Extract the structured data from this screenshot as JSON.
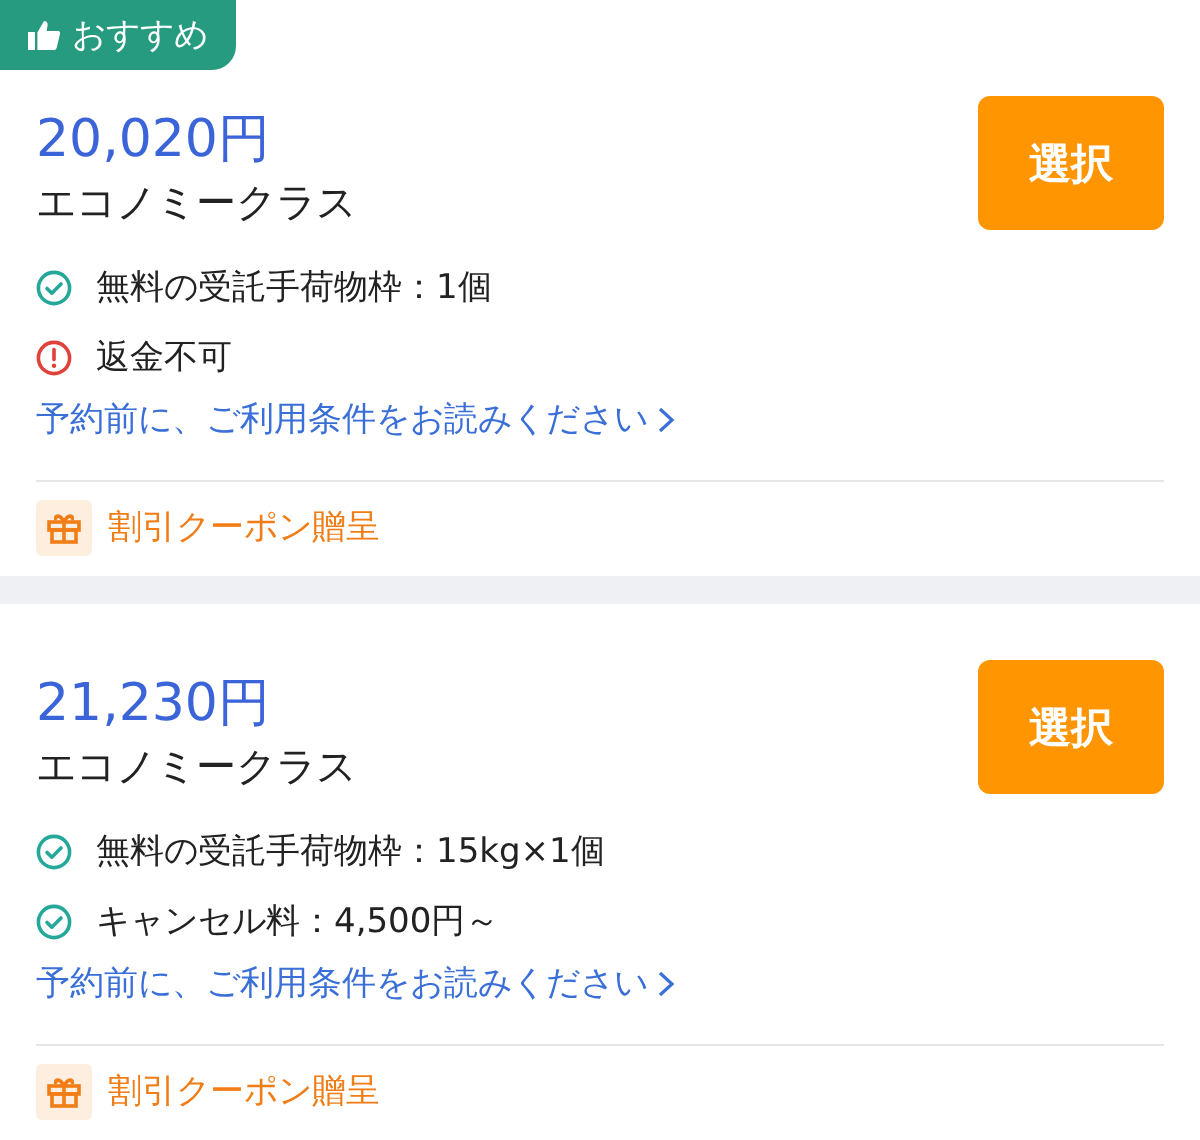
{
  "offers": [
    {
      "badge": {
        "label": "おすすめ"
      },
      "price": "20,020円",
      "fare_class": "エコノミークラス",
      "select_button": "選択",
      "features": [
        {
          "kind": "included",
          "text": "無料の受託手荷物枠：1個"
        },
        {
          "kind": "warning",
          "text": "返金不可"
        }
      ],
      "terms_link": "予約前に、ご利用条件をお読みください",
      "coupon": "割引クーポン贈呈"
    },
    {
      "price": "21,230円",
      "fare_class": "エコノミークラス",
      "select_button": "選択",
      "features": [
        {
          "kind": "included",
          "text": "無料の受託手荷物枠：15kg×1個"
        },
        {
          "kind": "included",
          "text": "キャンセル料：4,500円～"
        }
      ],
      "terms_link": "予約前に、ご利用条件をお読みください",
      "coupon": "割引クーポン贈呈"
    }
  ]
}
